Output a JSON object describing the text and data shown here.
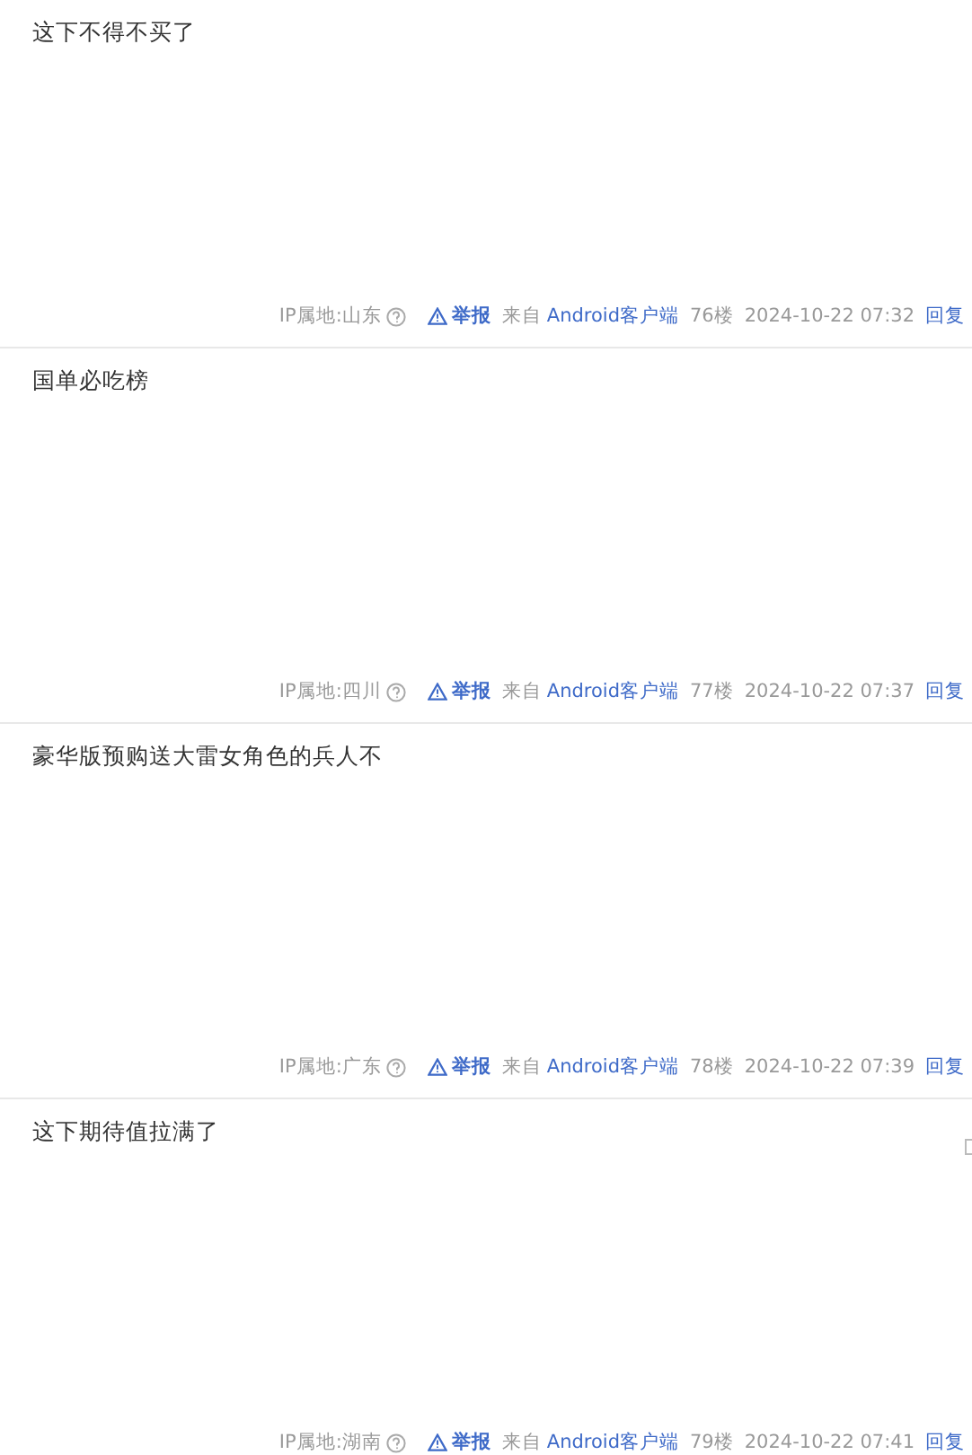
{
  "posts": [
    {
      "content": "这下不得不买了",
      "ip": "IP属地:山东",
      "report": "举报",
      "source_prefix": "来自",
      "source": "Android客户端",
      "floor": "76楼",
      "time": "2024-10-22 07:32",
      "reply": "回复",
      "side_icon": false
    },
    {
      "content": "国单必吃榜",
      "ip": "IP属地:四川",
      "report": "举报",
      "source_prefix": "来自",
      "source": "Android客户端",
      "floor": "77楼",
      "time": "2024-10-22 07:37",
      "reply": "回复",
      "side_icon": false
    },
    {
      "content": "豪华版预购送大雷女角色的兵人不",
      "ip": "IP属地:广东",
      "report": "举报",
      "source_prefix": "来自",
      "source": "Android客户端",
      "floor": "78楼",
      "time": "2024-10-22 07:39",
      "reply": "回复",
      "side_icon": false
    },
    {
      "content": "这下期待值拉满了",
      "ip": "IP属地:湖南",
      "report": "举报",
      "source_prefix": "来自",
      "source": "Android客户端",
      "floor": "79楼",
      "time": "2024-10-22 07:41",
      "reply": "回复",
      "side_icon": true
    }
  ]
}
